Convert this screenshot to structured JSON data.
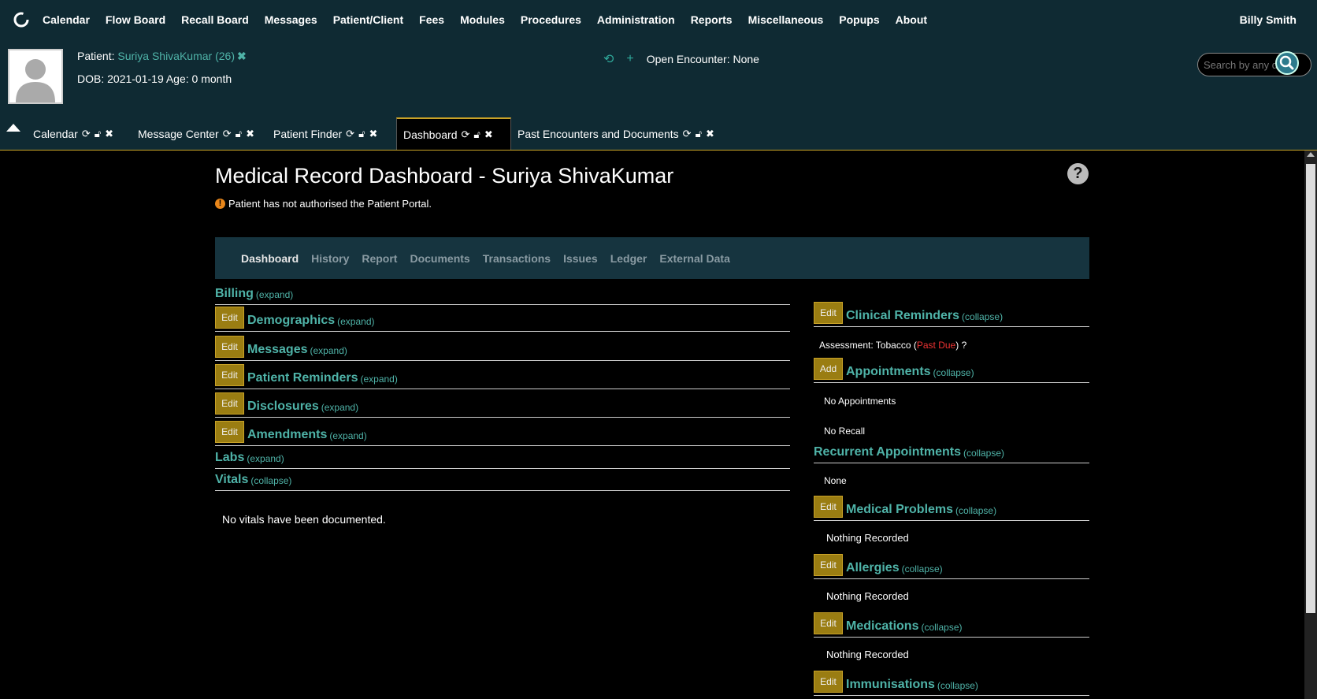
{
  "menu": [
    "Calendar",
    "Flow Board",
    "Recall Board",
    "Messages",
    "Patient/Client",
    "Fees",
    "Modules",
    "Procedures",
    "Administration",
    "Reports",
    "Miscellaneous",
    "Popups",
    "About"
  ],
  "user": "Billy Smith",
  "patient": {
    "label": "Patient:",
    "name": "Suriya ShivaKumar (26)",
    "dob_line": "DOB: 2021-01-19 Age: 0 month",
    "open_encounter": "Open Encounter: None"
  },
  "search": {
    "placeholder": "Search by any demographics"
  },
  "tabs": [
    "Calendar",
    "Message Center",
    "Patient Finder",
    "Dashboard",
    "Past Encounters and Documents"
  ],
  "page": {
    "title": "Medical Record Dashboard - Suriya ShivaKumar",
    "portal_note": "Patient has not authorised the Patient Portal."
  },
  "subnav": [
    "Dashboard",
    "History",
    "Report",
    "Documents",
    "Transactions",
    "Issues",
    "Ledger",
    "External Data"
  ],
  "buttons": {
    "edit": "Edit",
    "add": "Add"
  },
  "left_sections": [
    {
      "title": "Billing",
      "toggle": "(expand)"
    },
    {
      "title": "Demographics",
      "toggle": "(expand)"
    },
    {
      "title": "Messages",
      "toggle": "(expand)"
    },
    {
      "title": "Patient Reminders",
      "toggle": "(expand)"
    },
    {
      "title": "Disclosures",
      "toggle": "(expand)"
    },
    {
      "title": "Amendments",
      "toggle": "(expand)"
    },
    {
      "title": "Labs",
      "toggle": "(expand)"
    },
    {
      "title": "Vitals",
      "toggle": "(collapse)"
    }
  ],
  "vitals_text": "No vitals have been documented.",
  "right_sections": [
    {
      "title": "Clinical Reminders",
      "toggle": "(collapse)"
    },
    {
      "title": "Appointments",
      "toggle": "(collapse)"
    },
    {
      "title": "Recurrent Appointments",
      "toggle": "(collapse)"
    },
    {
      "title": "Medical Problems",
      "toggle": "(collapse)"
    },
    {
      "title": "Allergies",
      "toggle": "(collapse)"
    },
    {
      "title": "Medications",
      "toggle": "(collapse)"
    },
    {
      "title": "Immunisations",
      "toggle": "(collapse)"
    }
  ],
  "right_text": {
    "reminder_prefix": "Assessment: Tobacco",
    "reminder_status": "Past Due",
    "reminder_suffix": "?",
    "no_appointments": "No Appointments",
    "no_recall": "No Recall",
    "recurrent_none": "None",
    "nothing_recorded": "Nothing Recorded"
  },
  "colors": {
    "topbar": "#0f2a33",
    "accent": "#4fb3a8",
    "button": "#9a7d12",
    "active_tab_border": "#c9a227",
    "past_due": "#e33333"
  }
}
